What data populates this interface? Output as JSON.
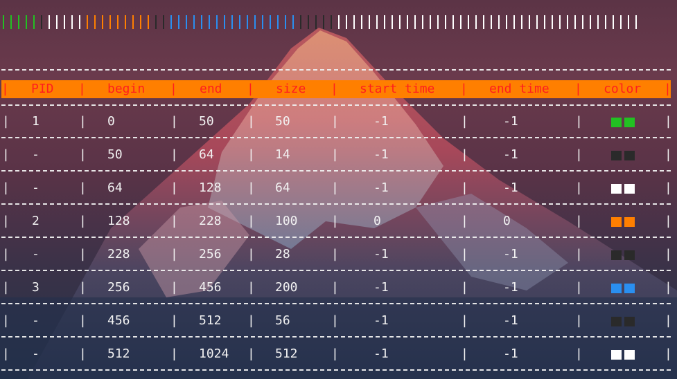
{
  "memory_bar": {
    "ticks": [
      {
        "color": "#22c022",
        "count": 5
      },
      {
        "color": "#2a2a2a",
        "count": 1
      },
      {
        "color": "#ffffff",
        "count": 5
      },
      {
        "color": "#ff7f00",
        "count": 9
      },
      {
        "color": "#2a2a2a",
        "count": 2
      },
      {
        "color": "#2a8ff0",
        "count": 17
      },
      {
        "color": "#2a2a2a",
        "count": 5
      },
      {
        "color": "#ffffff",
        "count": 40
      }
    ]
  },
  "table": {
    "columns": [
      "PID",
      "begin",
      "end",
      "size",
      "start time",
      "end time",
      "color"
    ],
    "rows": [
      {
        "pid": "1",
        "begin": "0",
        "end": "50",
        "size": "50",
        "start": "-1",
        "end_time": "-1",
        "color": "#22c022"
      },
      {
        "pid": "-",
        "begin": "50",
        "end": "64",
        "size": "14",
        "start": "-1",
        "end_time": "-1",
        "color": "#2a2a2a"
      },
      {
        "pid": "-",
        "begin": "64",
        "end": "128",
        "size": "64",
        "start": "-1",
        "end_time": "-1",
        "color": "#ffffff"
      },
      {
        "pid": "2",
        "begin": "128",
        "end": "228",
        "size": "100",
        "start": "0",
        "end_time": "0",
        "color": "#ff7f00"
      },
      {
        "pid": "-",
        "begin": "228",
        "end": "256",
        "size": "28",
        "start": "-1",
        "end_time": "-1",
        "color": "#2a2a2a"
      },
      {
        "pid": "3",
        "begin": "256",
        "end": "456",
        "size": "200",
        "start": "-1",
        "end_time": "-1",
        "color": "#2a8ff0"
      },
      {
        "pid": "-",
        "begin": "456",
        "end": "512",
        "size": "56",
        "start": "-1",
        "end_time": "-1",
        "color": "#2a2a2a"
      },
      {
        "pid": "-",
        "begin": "512",
        "end": "1024",
        "size": "512",
        "start": "-1",
        "end_time": "-1",
        "color": "#ffffff"
      }
    ]
  },
  "colors": {
    "header_bg": "#ff7f00",
    "header_text": "#ff1e1e",
    "text": "#f2f2f2"
  }
}
